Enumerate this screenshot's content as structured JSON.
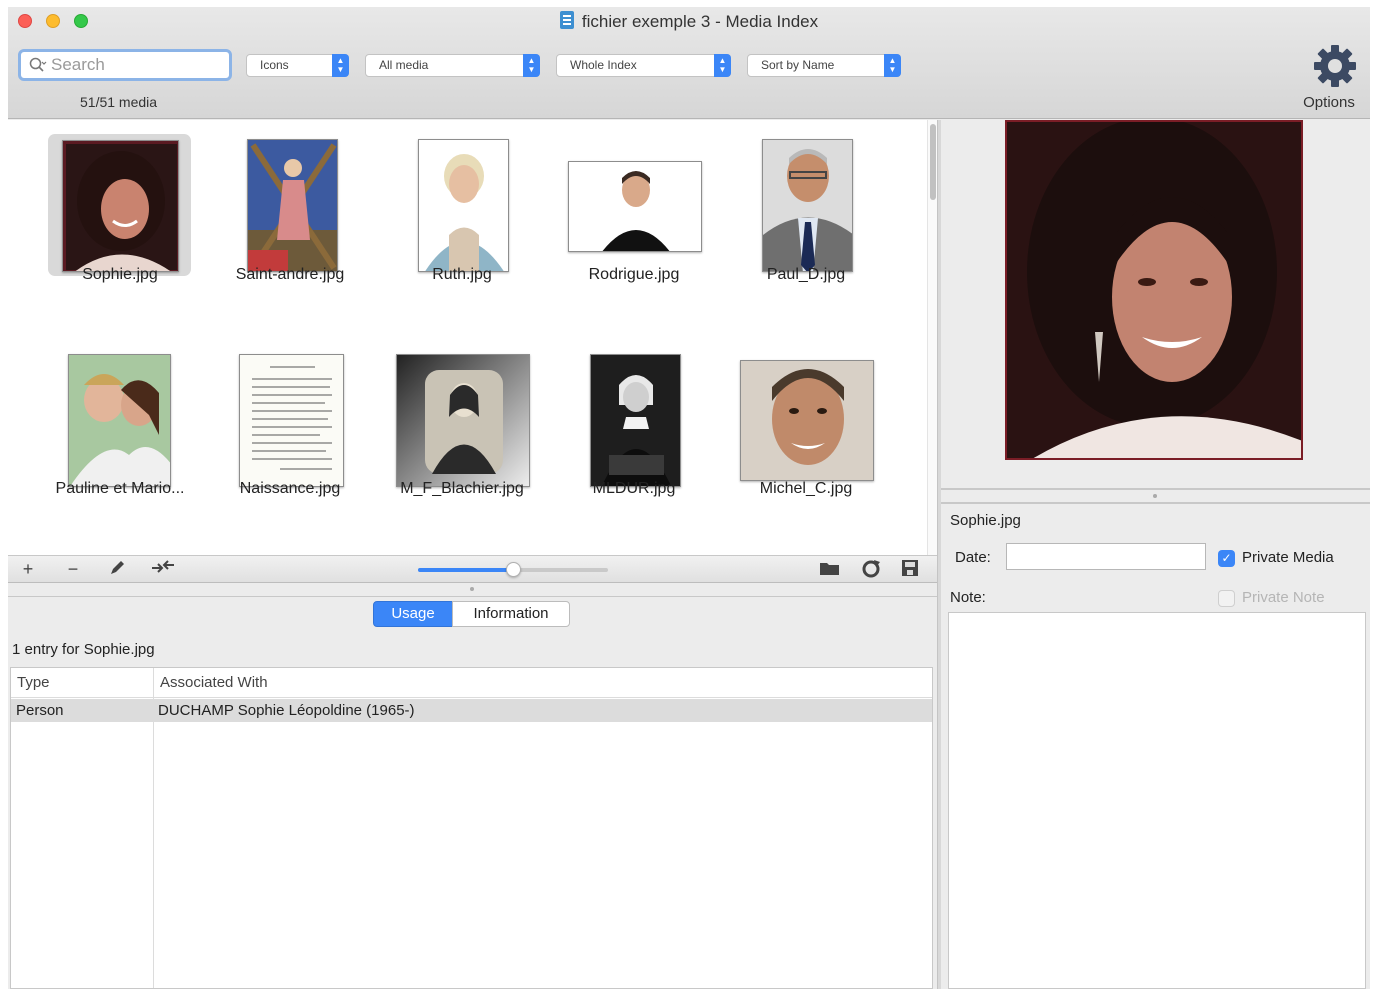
{
  "window": {
    "title": "fichier exemple 3 - Media Index"
  },
  "toolbar": {
    "search_placeholder": "Search",
    "media_count": "51/51 media",
    "view_select": "Icons",
    "media_select": "All media",
    "scope_select": "Whole Index",
    "sort_select": "Sort by Name",
    "options_label": "Options"
  },
  "media": [
    {
      "name": "Sophie.jpg",
      "selected": true
    },
    {
      "name": "Saint-andre.jpg"
    },
    {
      "name": "Ruth.jpg"
    },
    {
      "name": "Rodrigue.jpg"
    },
    {
      "name": "Paul_D.jpg"
    },
    {
      "name": "Pauline et Mario..."
    },
    {
      "name": "Naissance.jpg"
    },
    {
      "name": "M_F_Blachier.jpg"
    },
    {
      "name": "MLDUR.jpg"
    },
    {
      "name": "Michel_C.jpg"
    }
  ],
  "grid_bar": {
    "add_label": "+",
    "remove_label": "−",
    "zoom_level": 0.5
  },
  "tabs": {
    "usage": "Usage",
    "information": "Information"
  },
  "usage": {
    "entry_count": "1 entry for Sophie.jpg",
    "columns": [
      "Type",
      "Associated With"
    ],
    "rows": [
      {
        "type": "Person",
        "associated": "DUCHAMP Sophie Léopoldine (1965-)"
      }
    ]
  },
  "details": {
    "file_name": "Sophie.jpg",
    "date_label": "Date:",
    "date_value": "",
    "private_media_label": "Private Media",
    "private_media_checked": true,
    "note_label": "Note:",
    "private_note_label": "Private Note",
    "private_note_checked": false
  },
  "colors": {
    "accent": "#3b86f7",
    "selection": "#dcdcdc"
  }
}
